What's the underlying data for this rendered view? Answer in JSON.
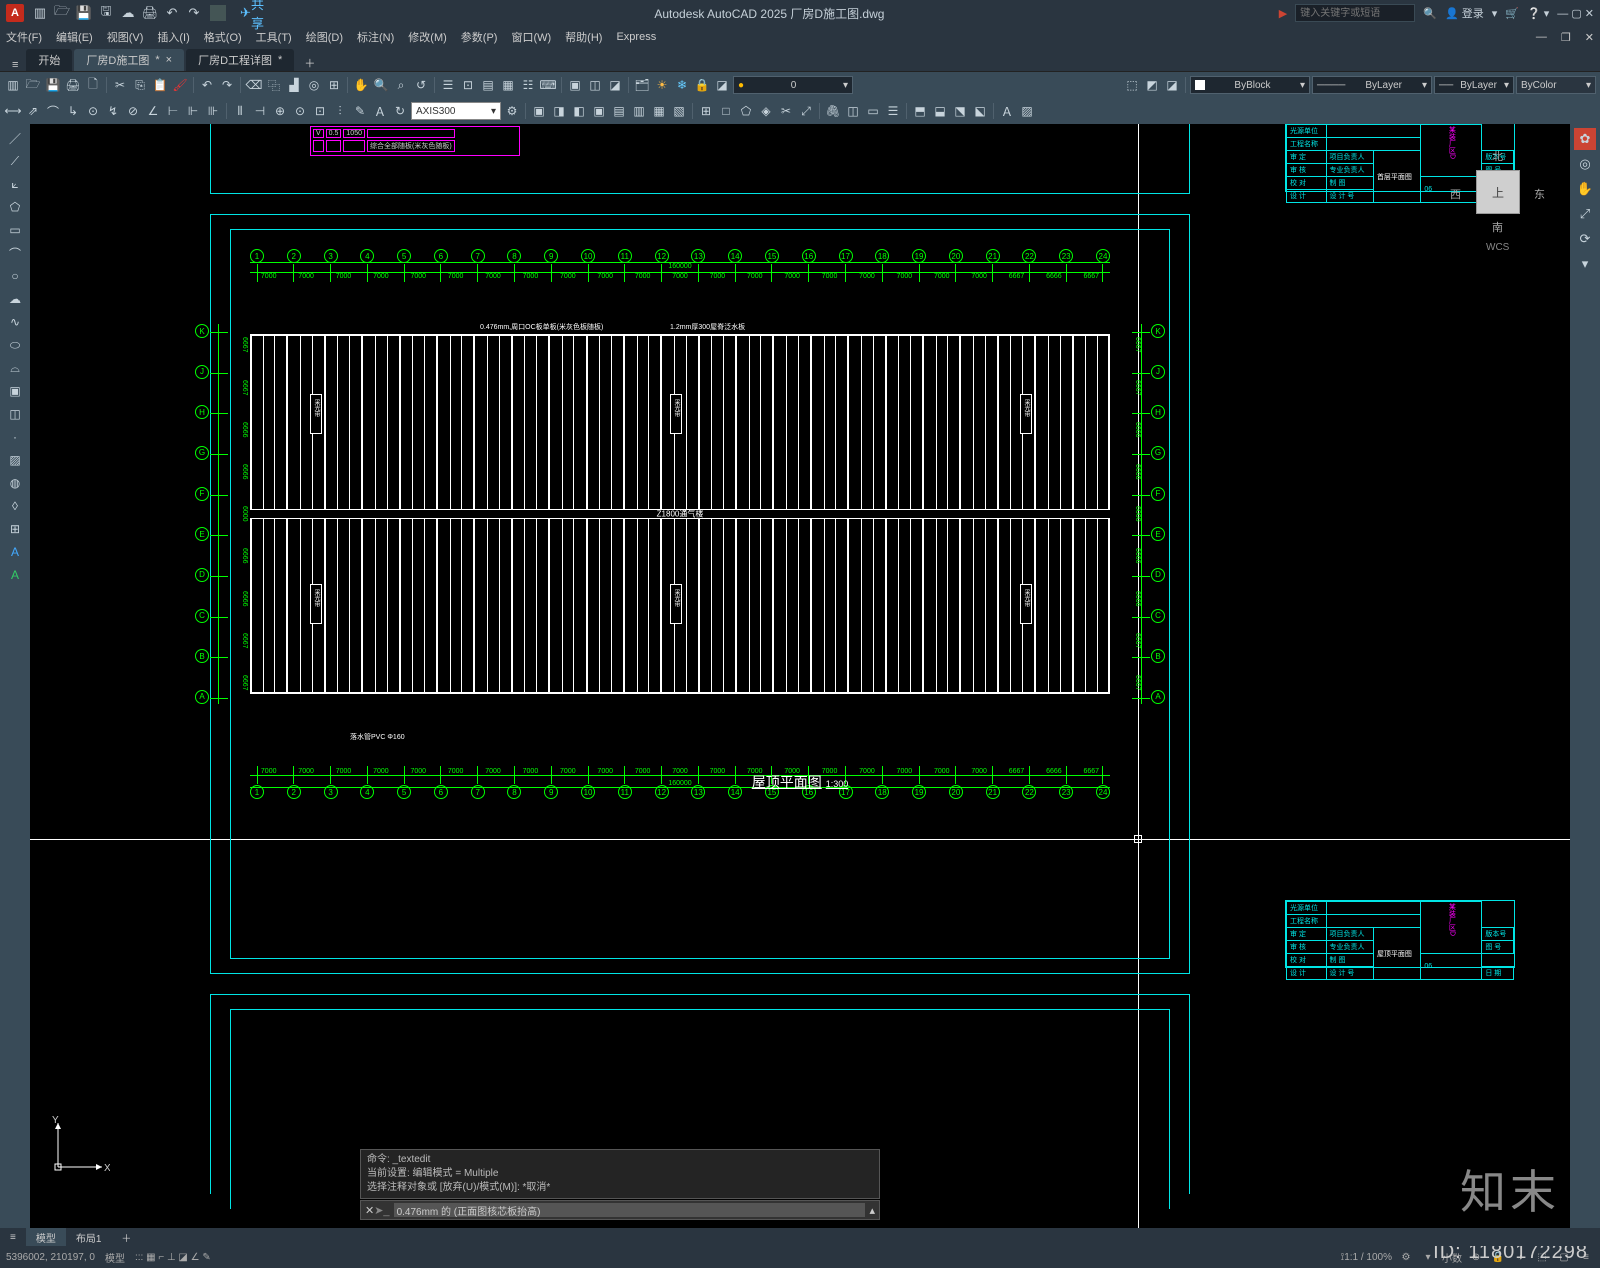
{
  "app": {
    "name": "Autodesk AutoCAD 2025",
    "file": "厂房D施工图.dwg"
  },
  "title_full": "Autodesk AutoCAD 2025   厂房D施工图.dwg",
  "qat": {
    "share": "共享"
  },
  "search": {
    "placeholder": "键入关键字或短语"
  },
  "login_label": "登录",
  "menus": [
    "文件(F)",
    "编辑(E)",
    "视图(V)",
    "插入(I)",
    "格式(O)",
    "工具(T)",
    "绘图(D)",
    "标注(N)",
    "修改(M)",
    "参数(P)",
    "窗口(W)",
    "帮助(H)",
    "Express"
  ],
  "tabs": {
    "items": [
      {
        "label": "开始",
        "active": false,
        "dirty": false
      },
      {
        "label": "厂房D施工图",
        "active": true,
        "dirty": true
      },
      {
        "label": "厂房D工程详图",
        "active": false,
        "dirty": true
      }
    ]
  },
  "ribbon": {
    "layer_filter_value": "0",
    "color_value": "ByBlock",
    "linetype_value": "ByLayer",
    "lineweight_value": "ByLayer",
    "plotstyle_value": "ByColor",
    "dimstyle_value": "AXIS300"
  },
  "viewcube": {
    "face": "上",
    "n": "北",
    "s": "南",
    "e": "东",
    "w": "西",
    "wcs": "WCS"
  },
  "ucs": {
    "x": "X",
    "y": "Y"
  },
  "command": {
    "prompt_cmd": "_textedit",
    "line1": "命令: _textedit",
    "line2": "当前设置: 编辑模式 = Multiple",
    "line3": "选择注释对象或 [放弃(U)/模式(M)]: *取消*",
    "input_hint": "0.476mm 的 (正面图核芯板抬高)"
  },
  "layout_tabs": {
    "model": "模型",
    "l1": "布局1"
  },
  "status": {
    "coords": "5396002, 210197, 0",
    "mode": "模型",
    "grid": "::: ▦ ⌐ ⊥ ◪ ∠ ✎",
    "scale": "1:1 / 100%",
    "anno": "小数",
    "extra": "▾ ⊕ 🔒 ▼ ≡"
  },
  "drawing": {
    "plan_title": "屋顶平面图",
    "plan_scale": "1:300",
    "top_frame_title": "首层平面图",
    "total_dim": "160000",
    "col_dims": [
      "7000",
      "7000",
      "7000",
      "7000",
      "7000",
      "7000",
      "7000",
      "7000",
      "7000",
      "7000",
      "7000",
      "7000",
      "7000",
      "7000",
      "7000",
      "7000",
      "7000",
      "7000",
      "7000",
      "7000",
      "6667",
      "6666",
      "6667"
    ],
    "col_grids": [
      "1",
      "2",
      "3",
      "4",
      "5",
      "6",
      "7",
      "8",
      "9",
      "10",
      "11",
      "12",
      "13",
      "14",
      "15",
      "16",
      "17",
      "18",
      "19",
      "20",
      "21",
      "22",
      "23",
      "24"
    ],
    "row_grids": [
      "A",
      "B",
      "C",
      "D",
      "E",
      "F",
      "G",
      "H",
      "J",
      "K"
    ],
    "row_dims": [
      "6667",
      "6667",
      "6666",
      "6666",
      "6000",
      "6666",
      "6666",
      "6667",
      "6667"
    ],
    "ridge_label": "Z1800通气楼",
    "roof_note1": "0.476mm,周口OC板单板(米灰色板随板)",
    "roof_note2": "1.2mm厚300屋脊泛水板",
    "gutter_note": "落水管PVC Φ160",
    "skylight_label": "采光带"
  },
  "titleblock": {
    "fields": [
      {
        "k": "光源单位",
        "v": ""
      },
      {
        "k": "工程名称",
        "v": ""
      }
    ],
    "project": "某装厂区D",
    "drawing1": "首层平面图",
    "drawing2": "屋顶平面图",
    "rows": [
      {
        "a": "审 定",
        "b": "项目负责人"
      },
      {
        "a": "审 核",
        "b": "专业负责人"
      },
      {
        "a": "校 对",
        "b": "制 图"
      },
      {
        "a": "设 计",
        "b": "设 计 号"
      }
    ],
    "cols2": [
      "版本号",
      "图 号",
      "日 期"
    ],
    "sheet": "06"
  },
  "overlay": {
    "brand": "知末",
    "id": "ID: 1180172298"
  }
}
